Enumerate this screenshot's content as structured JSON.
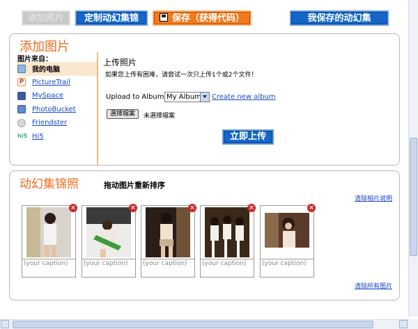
{
  "toolbar": {
    "add_photo": "添加照片",
    "customize": "定制动幻集锦",
    "save": "保存（获得代码）",
    "my_saved": "我保存的动幻集"
  },
  "add_panel": {
    "title": "添加图片",
    "source_heading": "图片来自：",
    "sources": [
      {
        "label": "我的电脑",
        "icon": "computer-icon"
      },
      {
        "label": "PictureTrail",
        "icon": "picturetrail-icon"
      },
      {
        "label": "MySpace",
        "icon": "myspace-icon"
      },
      {
        "label": "PhotoBucket",
        "icon": "photobucket-icon"
      },
      {
        "label": "Friendster",
        "icon": "friendster-icon"
      },
      {
        "label": "Hi5",
        "icon": "hi5-icon"
      }
    ],
    "upload_title": "上传照片",
    "upload_note": "如果您上传有困难，请尝试一次只上传1个或2个文件！",
    "album_label": "Upload to Album:",
    "album_selected": "My Album",
    "create_album": "Create new album",
    "file_button": "選擇檔案",
    "file_status": "未選擇檔案",
    "upload_button": "立即上传"
  },
  "slide_panel": {
    "title": "动幻集锦照",
    "drag_hint": "拖动图片重新排序",
    "clear_descriptions": "清除相片说明",
    "clear_all": "清除所有图片",
    "caption_placeholder": "(your caption)",
    "thumbnails": [
      {
        "delete": "×"
      },
      {
        "delete": "×"
      },
      {
        "delete": "×"
      },
      {
        "delete": "×"
      },
      {
        "delete": "×"
      }
    ]
  }
}
